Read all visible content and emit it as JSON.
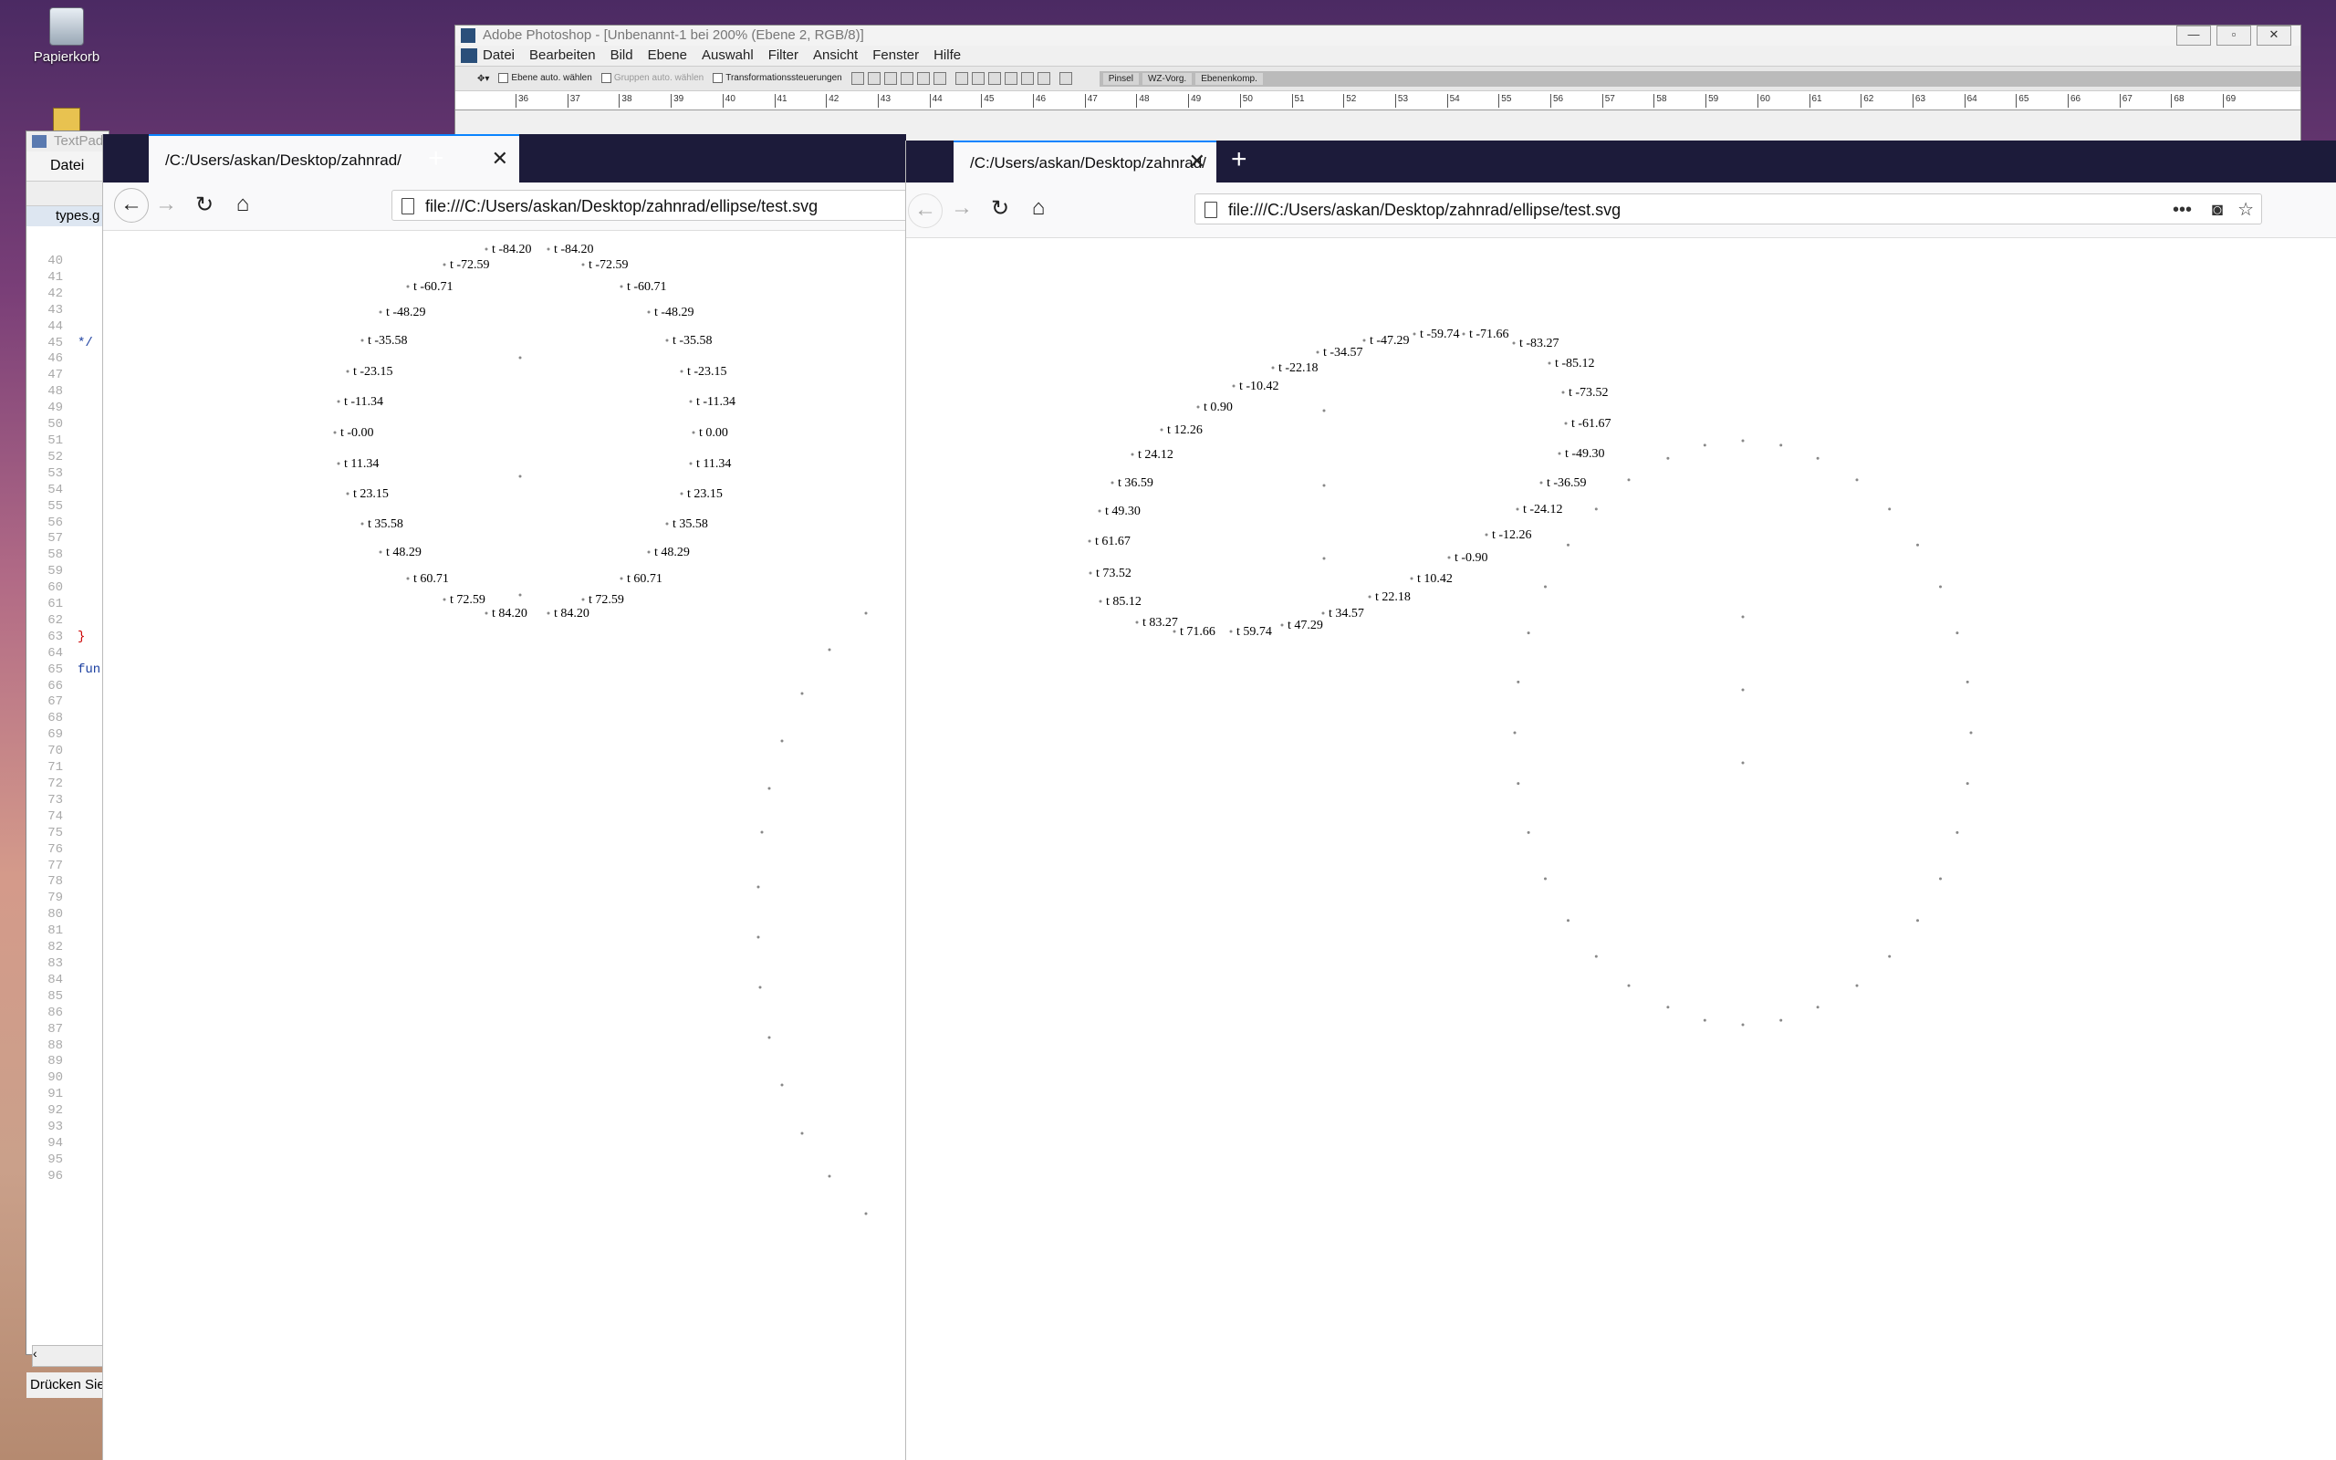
{
  "desktop": {
    "recycle_bin_label": "Papierkorb"
  },
  "photoshop": {
    "title": "Adobe Photoshop - [Unbenannt-1 bei 200% (Ebene 2, RGB/8)]",
    "menu": [
      "Datei",
      "Bearbeiten",
      "Bild",
      "Ebene",
      "Auswahl",
      "Filter",
      "Ansicht",
      "Fenster",
      "Hilfe"
    ],
    "options": {
      "auto_select_layer": "Ebene auto. wählen",
      "auto_select_group": "Gruppen auto. wählen",
      "transform_controls": "Transformationssteuerungen"
    },
    "panel_tabs": [
      "Pinsel",
      "WZ-Vorg.",
      "Ebenenkomp."
    ],
    "ruler_ticks": [
      "36",
      "37",
      "38",
      "39",
      "40",
      "41",
      "42",
      "43",
      "44",
      "45",
      "46",
      "47",
      "48",
      "49",
      "50",
      "51",
      "52",
      "53",
      "54",
      "55",
      "56",
      "57",
      "58",
      "59",
      "60",
      "61",
      "62",
      "63",
      "64",
      "65",
      "66",
      "67",
      "68",
      "69"
    ]
  },
  "textpad": {
    "title": "TextPad",
    "menu_file": "Datei",
    "doc_tab": "types.g",
    "status": "Drücken Sie",
    "line_numbers_start": 40,
    "line_numbers_end": 96,
    "code_fragments": [
      {
        "line": 45,
        "text": "*/"
      },
      {
        "line": 63,
        "text": "}"
      },
      {
        "line": 65,
        "text": "fun"
      }
    ]
  },
  "firefox_left": {
    "tab_title": "/C:/Users/askan/Desktop/zahnrad/",
    "url": "file:///C:/Users/askan/Desktop/zahnrad/ellipse/test.svg",
    "labels": [
      {
        "text": "t -84.20"
      },
      {
        "text": "t -84.20"
      },
      {
        "text": "t -72.59"
      },
      {
        "text": "t -72.59"
      },
      {
        "text": "t -60.71"
      },
      {
        "text": "t -60.71"
      },
      {
        "text": "t -48.29"
      },
      {
        "text": "t -48.29"
      },
      {
        "text": "t -35.58"
      },
      {
        "text": "t -35.58"
      },
      {
        "text": "t -23.15"
      },
      {
        "text": "t -23.15"
      },
      {
        "text": "t -11.34"
      },
      {
        "text": "t -11.34"
      },
      {
        "text": "t -0.00"
      },
      {
        "text": "t 0.00"
      },
      {
        "text": "t 11.34"
      },
      {
        "text": "t 11.34"
      },
      {
        "text": "t 23.15"
      },
      {
        "text": "t 23.15"
      },
      {
        "text": "t 35.58"
      },
      {
        "text": "t 35.58"
      },
      {
        "text": "t 48.29"
      },
      {
        "text": "t 48.29"
      },
      {
        "text": "t 60.71"
      },
      {
        "text": "t 60.71"
      },
      {
        "text": "t 72.59"
      },
      {
        "text": "t 72.59"
      },
      {
        "text": "t 84.20"
      },
      {
        "text": "t 84.20"
      }
    ]
  },
  "firefox_right": {
    "tab_title": "/C:/Users/askan/Desktop/zahnrad/",
    "url": "file:///C:/Users/askan/Desktop/zahnrad/ellipse/test.svg",
    "labels": [
      {
        "text": "t -59.74"
      },
      {
        "text": "t -71.66"
      },
      {
        "text": "t -47.29"
      },
      {
        "text": "t -83.27"
      },
      {
        "text": "t -34.57"
      },
      {
        "text": "t -22.18"
      },
      {
        "text": "t -85.12"
      },
      {
        "text": "t -10.42"
      },
      {
        "text": "t -73.52"
      },
      {
        "text": "t 0.90"
      },
      {
        "text": "t -61.67"
      },
      {
        "text": "t 12.26"
      },
      {
        "text": "t 24.12"
      },
      {
        "text": "t -49.30"
      },
      {
        "text": "t 36.59"
      },
      {
        "text": "t -36.59"
      },
      {
        "text": "t 49.30"
      },
      {
        "text": "t -24.12"
      },
      {
        "text": "t -12.26"
      },
      {
        "text": "t 61.67"
      },
      {
        "text": "t -0.90"
      },
      {
        "text": "t 10.42"
      },
      {
        "text": "t 73.52"
      },
      {
        "text": "t 22.18"
      },
      {
        "text": "t 85.12"
      },
      {
        "text": "t 34.57"
      },
      {
        "text": "t 83.27"
      },
      {
        "text": "t 47.29"
      },
      {
        "text": "t 71.66"
      },
      {
        "text": "t 59.74"
      }
    ]
  }
}
